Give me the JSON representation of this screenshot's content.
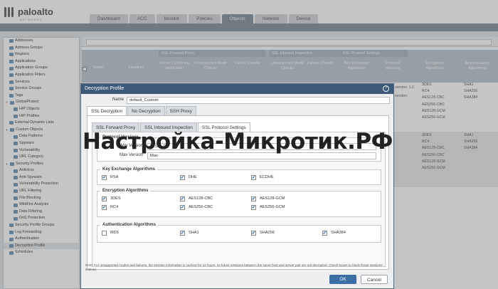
{
  "brand": {
    "name": "paloalto",
    "sub": "NETWORKS"
  },
  "nav_tabs": [
    "Dashboard",
    "ACC",
    "Monitor",
    "Policies",
    "Objects",
    "Network",
    "Device"
  ],
  "active_tab": "Objects",
  "sidebar": [
    {
      "label": "Addresses",
      "indent": 1
    },
    {
      "label": "Address Groups",
      "indent": 1
    },
    {
      "label": "Regions",
      "indent": 1
    },
    {
      "label": "Applications",
      "indent": 1
    },
    {
      "label": "Application Groups",
      "indent": 1
    },
    {
      "label": "Application Filters",
      "indent": 1
    },
    {
      "label": "Services",
      "indent": 1
    },
    {
      "label": "Service Groups",
      "indent": 1
    },
    {
      "label": "Tags",
      "indent": 1
    },
    {
      "label": "GlobalProtect",
      "indent": 0
    },
    {
      "label": "HIP Objects",
      "indent": 2
    },
    {
      "label": "HIP Profiles",
      "indent": 2
    },
    {
      "label": "External Dynamic Lists",
      "indent": 1
    },
    {
      "label": "Custom Objects",
      "indent": 0
    },
    {
      "label": "Data Patterns",
      "indent": 2
    },
    {
      "label": "Spyware",
      "indent": 2
    },
    {
      "label": "Vulnerability",
      "indent": 2
    },
    {
      "label": "URL Category",
      "indent": 2
    },
    {
      "label": "Security Profiles",
      "indent": 0
    },
    {
      "label": "Antivirus",
      "indent": 2
    },
    {
      "label": "Anti-Spyware",
      "indent": 2
    },
    {
      "label": "Vulnerability Protection",
      "indent": 2
    },
    {
      "label": "URL Filtering",
      "indent": 2
    },
    {
      "label": "File Blocking",
      "indent": 2
    },
    {
      "label": "WildFire Analysis",
      "indent": 2
    },
    {
      "label": "Data Filtering",
      "indent": 2
    },
    {
      "label": "DoS Protection",
      "indent": 2
    },
    {
      "label": "Security Profile Groups",
      "indent": 1
    },
    {
      "label": "Log Forwarding",
      "indent": 1
    },
    {
      "label": "Authentication",
      "indent": 1
    },
    {
      "label": "Decryption Profile",
      "indent": 1,
      "active": true
    },
    {
      "label": "Schedules",
      "indent": 1
    }
  ],
  "grid": {
    "group_headers": [
      "SSL Forward Proxy",
      "SSL Inbound Inspection",
      "SSL Protocol Settings"
    ],
    "columns": [
      "Name",
      "Location",
      "Server Certificate Verification",
      "Unsupported Mode Checks",
      "Failure Checks",
      "Unsupported Mode Checks",
      "Failure Checks",
      "Key Exchange Algorithms",
      "Protocol Versions",
      "Encryption Algorithms",
      "Authentication Algorithms"
    ],
    "visible_cells": {
      "protocol_1": "version: 1.0",
      "protocol_2": "version:",
      "enc_1": [
        "3DES",
        "RC4",
        "AES128-CBC",
        "AES256-CBC",
        "AES128-GCM",
        "AES256-GCM"
      ],
      "auth_1": [
        "SHA1",
        "SHA256",
        "SHA384"
      ],
      "enc_2": [
        "3DES",
        "RC4",
        "AES128-CBC",
        "AES256-CBC",
        "AES128-GCM",
        "AES256-GCM"
      ],
      "auth_2": [
        "SHA1",
        "SHA256",
        "SHA384"
      ]
    }
  },
  "modal": {
    "title": "Decryption Profile",
    "name_label": "Name",
    "name_value": "default_Custom",
    "tabs": [
      "SSL Decryption",
      "No Decryption",
      "SSH Proxy"
    ],
    "subtabs": [
      "SSL Forward Proxy",
      "SSL Inbound Inspection",
      "SSL Protocol Settings"
    ],
    "protocol_label": "Protocol Versions",
    "min_label": "Min Version",
    "min_value": "TLSv1.0",
    "max_label": "Max Version",
    "max_value": "Max",
    "key_exchange": {
      "title": "Key Exchange Algorithms",
      "items": [
        {
          "label": "RSA",
          "checked": true
        },
        {
          "label": "DHE",
          "checked": true
        },
        {
          "label": "ECDHE",
          "checked": true
        }
      ]
    },
    "encryption": {
      "title": "Encryption Algorithms",
      "items": [
        {
          "label": "3DES",
          "checked": true
        },
        {
          "label": "AES128-CBC",
          "checked": true
        },
        {
          "label": "AES128-GCM",
          "checked": true
        },
        {
          "label": "RC4",
          "checked": true
        },
        {
          "label": "AES256-CBC",
          "checked": true
        },
        {
          "label": "AES256-GCM",
          "checked": true
        }
      ]
    },
    "authentication": {
      "title": "Authentication Algorithms",
      "items": [
        {
          "label": "MD5",
          "checked": false
        },
        {
          "label": "SHA1",
          "checked": true
        },
        {
          "label": "SHA256",
          "checked": true
        },
        {
          "label": "SHA384",
          "checked": true
        }
      ]
    },
    "note": "Note: For unsupported modes and failures, the session information is cached for 12 hours, so future sessions between the same host and server pair are not decrypted. Check boxes to block those sessions instead.",
    "ok": "OK",
    "cancel": "Cancel"
  },
  "watermark": "Настройка-Микротик.РФ",
  "colors": {
    "ribbon": "#7d8d9a",
    "modal_title": "#3d5a7a",
    "ok_button": "#3c6ea6"
  }
}
